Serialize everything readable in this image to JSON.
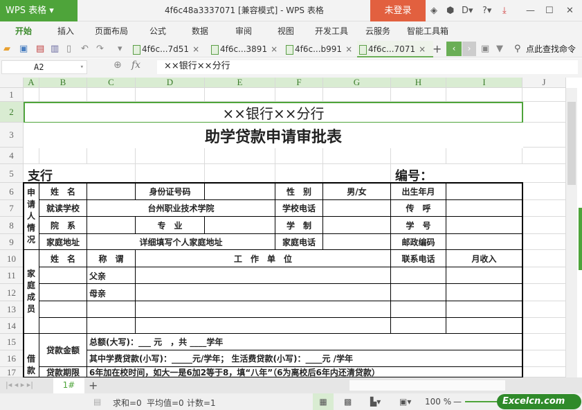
{
  "app": {
    "logo": "WPS 表格",
    "title": "4f6c48a3337071 [兼容模式] - WPS 表格",
    "login": "未登录"
  },
  "menu": [
    "开始",
    "插入",
    "页面布局",
    "公式",
    "数据",
    "审阅",
    "视图",
    "开发工具",
    "云服务",
    "智能工具箱"
  ],
  "doc_tabs": [
    {
      "label": "4f6c...7d51"
    },
    {
      "label": "4f6c...3891"
    },
    {
      "label": "4f6c...b991"
    },
    {
      "label": "4f6c...7071",
      "active": true
    }
  ],
  "search_label": "点此查找命令",
  "name_box": "A2",
  "fx_label": "fx",
  "formula": "××银行××分行",
  "columns": [
    "A",
    "B",
    "C",
    "D",
    "E",
    "F",
    "G",
    "H",
    "I",
    "J"
  ],
  "rows": [
    "1",
    "2",
    "3",
    "4",
    "5",
    "6",
    "7",
    "8",
    "9",
    "10",
    "11",
    "12",
    "13",
    "14",
    "15",
    "16",
    "17"
  ],
  "cells": [
    {
      "ref": "A2:I2",
      "text": "××银行××分行",
      "style": "title1"
    },
    {
      "ref": "A3:I3",
      "text": "助学贷款申请审批表",
      "style": "title2"
    },
    {
      "ref": "A5:B5",
      "text": "支行",
      "style": "sub"
    },
    {
      "ref": "H5:I5",
      "text": "编号：",
      "style": "sub"
    },
    {
      "ref": "A6:A9",
      "text": "申请人情况",
      "style": "vert"
    },
    {
      "ref": "B6",
      "text": "姓　名"
    },
    {
      "ref": "C6",
      "text": ""
    },
    {
      "ref": "D6",
      "text": "身份证号码"
    },
    {
      "ref": "E6",
      "text": ""
    },
    {
      "ref": "F6",
      "text": "性　别"
    },
    {
      "ref": "G6",
      "text": "男/女"
    },
    {
      "ref": "H6",
      "text": "出生年月"
    },
    {
      "ref": "I6",
      "text": ""
    },
    {
      "ref": "B7",
      "text": "就读学校"
    },
    {
      "ref": "C7:E7",
      "text": "台州职业技术学院"
    },
    {
      "ref": "F7",
      "text": "学校电话"
    },
    {
      "ref": "G7",
      "text": ""
    },
    {
      "ref": "H7",
      "text": "传　呼"
    },
    {
      "ref": "I7",
      "text": ""
    },
    {
      "ref": "B8",
      "text": "院　系"
    },
    {
      "ref": "C8",
      "text": ""
    },
    {
      "ref": "D8",
      "text": "专　业"
    },
    {
      "ref": "E8",
      "text": ""
    },
    {
      "ref": "F8",
      "text": "学　制"
    },
    {
      "ref": "G8",
      "text": ""
    },
    {
      "ref": "H8",
      "text": "学　号"
    },
    {
      "ref": "I8",
      "text": ""
    },
    {
      "ref": "B9",
      "text": "家庭地址"
    },
    {
      "ref": "C9:E9",
      "text": "详细填写个人家庭地址"
    },
    {
      "ref": "F9",
      "text": "家庭电话"
    },
    {
      "ref": "G9",
      "text": ""
    },
    {
      "ref": "H9",
      "text": "邮政编码"
    },
    {
      "ref": "I9",
      "text": ""
    },
    {
      "ref": "A10:A14",
      "text": "家庭成员",
      "style": "vert"
    },
    {
      "ref": "B10",
      "text": "姓　名"
    },
    {
      "ref": "C10",
      "text": "称　谓"
    },
    {
      "ref": "D10:G10",
      "text": "工　作　单　位"
    },
    {
      "ref": "H10",
      "text": "联系电话"
    },
    {
      "ref": "I10",
      "text": "月收入"
    },
    {
      "ref": "B11",
      "text": ""
    },
    {
      "ref": "C11",
      "text": "父亲",
      "style": "bl"
    },
    {
      "ref": "D11:G11",
      "text": ""
    },
    {
      "ref": "H11",
      "text": ""
    },
    {
      "ref": "I11",
      "text": ""
    },
    {
      "ref": "B12",
      "text": ""
    },
    {
      "ref": "C12",
      "text": "母亲",
      "style": "bl"
    },
    {
      "ref": "D12:G12",
      "text": ""
    },
    {
      "ref": "H12",
      "text": ""
    },
    {
      "ref": "I12",
      "text": ""
    },
    {
      "ref": "B13",
      "text": ""
    },
    {
      "ref": "C13",
      "text": ""
    },
    {
      "ref": "D13:G13",
      "text": ""
    },
    {
      "ref": "H13",
      "text": ""
    },
    {
      "ref": "I13",
      "text": ""
    },
    {
      "ref": "B14",
      "text": ""
    },
    {
      "ref": "C14",
      "text": ""
    },
    {
      "ref": "D14:G14",
      "text": ""
    },
    {
      "ref": "H14",
      "text": ""
    },
    {
      "ref": "I14",
      "text": ""
    },
    {
      "ref": "A15:A17",
      "text": "借款",
      "style": "vertlow"
    },
    {
      "ref": "B15:B16",
      "text": "贷款金额"
    },
    {
      "ref": "C15:I15",
      "text": "总额(大写)：___ 元　，共 ____学年",
      "style": "left"
    },
    {
      "ref": "C16:I16",
      "text": "其中学费贷款(小写)：_____元/学年； 生活费贷款(小写)：____元 /学年",
      "style": "left"
    },
    {
      "ref": "B17",
      "text": "贷款期限"
    },
    {
      "ref": "C17:I17",
      "text": "6年加在校时间，如大一是6加2等于8，填“八年”（6为离校后6年内还清贷款）",
      "style": "left"
    }
  ],
  "sheet_tabs": [
    "1#"
  ],
  "status": {
    "sum": "求和=0",
    "avg": "平均值=0",
    "count": "计数=1",
    "zoom": "100 %"
  },
  "watermark": "Excelcn.com",
  "colors": {
    "accent": "#4ea43a",
    "login": "#e2603f"
  }
}
